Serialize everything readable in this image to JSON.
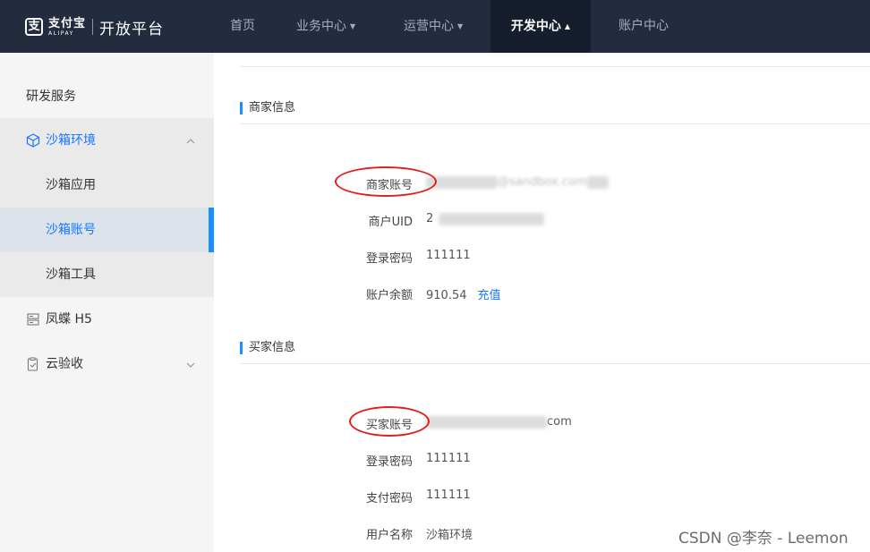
{
  "brand": {
    "logo_cn": "支付宝",
    "logo_en": "ALIPAY",
    "platform": "开放平台"
  },
  "nav": {
    "items": [
      {
        "label": "首页"
      },
      {
        "label": "业务中心"
      },
      {
        "label": "运营中心"
      },
      {
        "label": "开发中心"
      },
      {
        "label": "账户中心"
      }
    ]
  },
  "sidebar": {
    "heading": "研发服务",
    "items": [
      {
        "label": "沙箱环境",
        "icon": "cube-icon"
      },
      {
        "label": "沙箱应用"
      },
      {
        "label": "沙箱账号"
      },
      {
        "label": "沙箱工具"
      },
      {
        "label": "凤蝶 H5",
        "icon": "server-icon"
      },
      {
        "label": "云验收",
        "icon": "clipboard-check-icon"
      }
    ]
  },
  "merchant": {
    "title": "商家信息",
    "account_label": "商家账号",
    "account_value_visible": "@sandbox.com",
    "uid_label": "商户UID",
    "uid_value_visible": "2",
    "password_label": "登录密码",
    "password_value": "111111",
    "balance_label": "账户余额",
    "balance_value": "910.54",
    "recharge_link": "充值"
  },
  "buyer": {
    "title": "买家信息",
    "account_label": "买家账号",
    "account_value_visible": "com",
    "login_password_label": "登录密码",
    "login_password_value": "111111",
    "pay_password_label": "支付密码",
    "pay_password_value": "111111",
    "username_label": "用户名称",
    "username_value": "沙箱环境"
  },
  "watermark": "CSDN @李奈 - Leemon",
  "colors": {
    "topbar": "#232b3e",
    "accent": "#1890ff",
    "annotation": "#e02020"
  }
}
